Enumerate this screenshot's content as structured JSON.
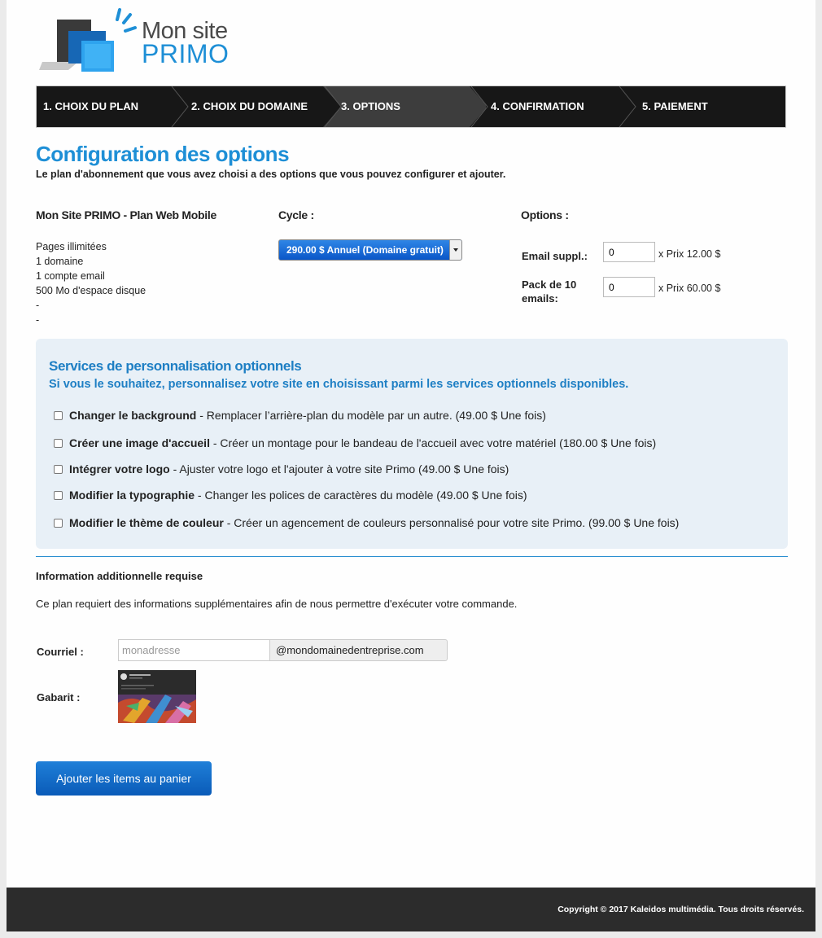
{
  "logo": {
    "line1": "Mon site",
    "line2": "PRIMO"
  },
  "steps": [
    {
      "label": "1. CHOIX DU PLAN",
      "active": false
    },
    {
      "label": "2. CHOIX DU DOMAINE",
      "active": false
    },
    {
      "label": "3. OPTIONS",
      "active": true
    },
    {
      "label": "4. CONFIRMATION",
      "active": false
    },
    {
      "label": "5. PAIEMENT",
      "active": false
    }
  ],
  "page": {
    "title": "Configuration des options",
    "subtitle": "Le plan d'abonnement que vous avez choisi a des options que vous pouvez configurer et ajouter."
  },
  "plan": {
    "name": "Mon Site PRIMO - Plan Web Mobile",
    "features": [
      "Pages illimitées",
      "1 domaine",
      "1 compte email",
      "500 Mo d'espace disque",
      "-",
      "-"
    ]
  },
  "cycle": {
    "label": "Cycle :",
    "selected": "290.00 $ Annuel (Domaine gratuit)"
  },
  "options": {
    "label": "Options :",
    "items": [
      {
        "label": "Email suppl.:",
        "value": "0",
        "price": "x Prix 12.00 $"
      },
      {
        "label": "Pack de 10 emails:",
        "value": "0",
        "price": "x Prix 60.00 $"
      }
    ]
  },
  "services": {
    "title": "Services de personnalisation optionnels",
    "subtitle": "Si vous le souhaitez, personnalisez votre site en choisissant parmi les services optionnels disponibles.",
    "items": [
      {
        "name": "Changer le background",
        "desc": " - Remplacer l’arrière-plan du modèle par un autre. (49.00 $ Une fois)",
        "checked": false
      },
      {
        "name": "Créer une image d'accueil",
        "desc": " - Créer un montage pour le bandeau de l'accueil avec votre matériel (180.00 $ Une fois)",
        "checked": false
      },
      {
        "name": "Intégrer votre logo",
        "desc": " - Ajuster votre logo et l'ajouter à votre site Primo (49.00 $ Une fois)",
        "checked": false
      },
      {
        "name": "Modifier la typographie",
        "desc": " - Changer les polices de caractères du modèle (49.00 $ Une fois)",
        "checked": false
      },
      {
        "name": "Modifier le thème de couleur",
        "desc": " - Créer un agencement de couleurs personnalisé pour votre site Primo. (99.00 $ Une fois)",
        "checked": false
      }
    ]
  },
  "additional": {
    "title": "Information additionnelle requise",
    "text": "Ce plan requiert des informations supplémentaires afin de nous permettre d'exécuter votre commande.",
    "email_label": "Courriel :",
    "email_placeholder": "monadresse",
    "email_value": "",
    "email_suffix": "@mondomainedentreprise.com",
    "template_label": "Gabarit :"
  },
  "actions": {
    "add_to_cart": "Ajouter les items au panier"
  },
  "footer": {
    "copyright": "Copyright © 2017 Kaleidos multimédia. Tous droits réservés."
  },
  "colors": {
    "accent": "#1e8fd6",
    "steps_bg": "#171717",
    "active_step": "#3d3d3d",
    "services_bg": "#e8f0f7"
  }
}
